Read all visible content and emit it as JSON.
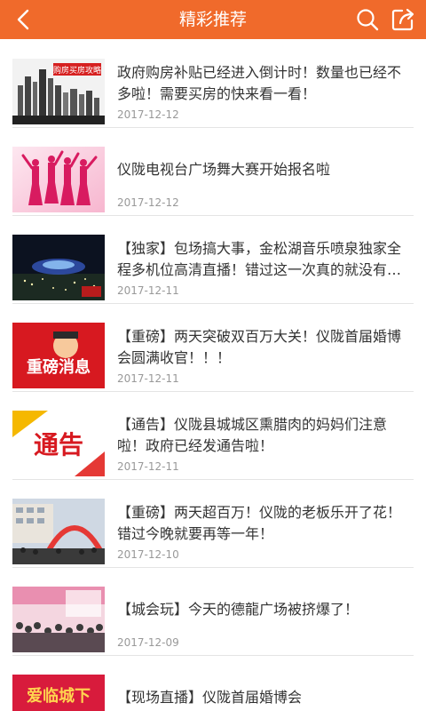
{
  "header": {
    "title": "精彩推荐",
    "back_icon": "back-arrow-icon",
    "search_icon": "search-icon",
    "share_icon": "share-edit-icon",
    "bg_color": "#f06a2b"
  },
  "articles": [
    {
      "title": "政府购房补贴已经进入倒计时！数量也已经不多啦！需要买房的快来看一看！",
      "date": "2017-12-12",
      "thumb_text": "购房买房攻略"
    },
    {
      "title": "仪陇电视台广场舞大赛开始报名啦",
      "date": "2017-12-12"
    },
    {
      "title": "【独家】包场搞大事，金松湖音乐喷泉独家全程多机位高清直播！错过这一次真的就没有…",
      "date": "2017-12-11"
    },
    {
      "title": "【重磅】两天突破双百万大关！仪陇首届婚博会圆满收官！！！",
      "date": "2017-12-11",
      "thumb_text": "重磅消息"
    },
    {
      "title": "【通告】仪陇县城城区熏腊肉的妈妈们注意啦！政府已经发通告啦！",
      "date": "2017-12-11",
      "thumb_text": "通告"
    },
    {
      "title": "【重磅】两天超百万！仪陇的老板乐开了花！错过今晚就要再等一年！",
      "date": "2017-12-10"
    },
    {
      "title": "【城会玩】今天的德龍广场被挤爆了！",
      "date": "2017-12-09"
    },
    {
      "title": "【现场直播】仪陇首届婚博会",
      "date": "",
      "thumb_text": "爱临城下"
    }
  ]
}
